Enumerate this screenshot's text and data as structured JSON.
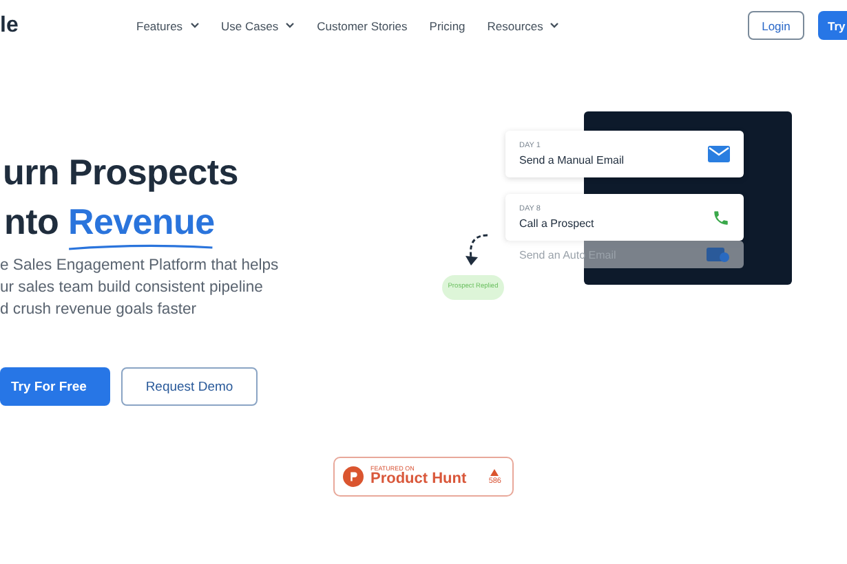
{
  "header": {
    "logo": "le",
    "nav": [
      {
        "label": "Features",
        "dropdown": true
      },
      {
        "label": "Use Cases",
        "dropdown": true
      },
      {
        "label": "Customer Stories",
        "dropdown": false
      },
      {
        "label": "Pricing",
        "dropdown": false
      },
      {
        "label": "Resources",
        "dropdown": true
      }
    ],
    "login": "Login",
    "cta": "Try"
  },
  "hero": {
    "title_line_1": "urn Prospects",
    "title_line_2_start": "nto",
    "title_line_2_highlight": "Revenue",
    "description": [
      "e Sales Engagement Platform that helps",
      "ur sales team build consistent pipeline",
      "d crush revenue goals faster"
    ],
    "primary_button": "Try For Free",
    "secondary_button": "Request Demo"
  },
  "illustration": {
    "steps": [
      {
        "kind": "email",
        "day": "DAY 1",
        "title": "Send a Manual Email"
      },
      {
        "kind": "call",
        "day": "DAY 8",
        "title": "Call a Prospect"
      },
      {
        "kind": "auto_email",
        "title": "Send an Auto Email"
      }
    ],
    "reply_bubble": "Prospect Replied"
  },
  "badge": {
    "kicker": "FEATURED ON",
    "name": "Product Hunt",
    "count": "586"
  }
}
